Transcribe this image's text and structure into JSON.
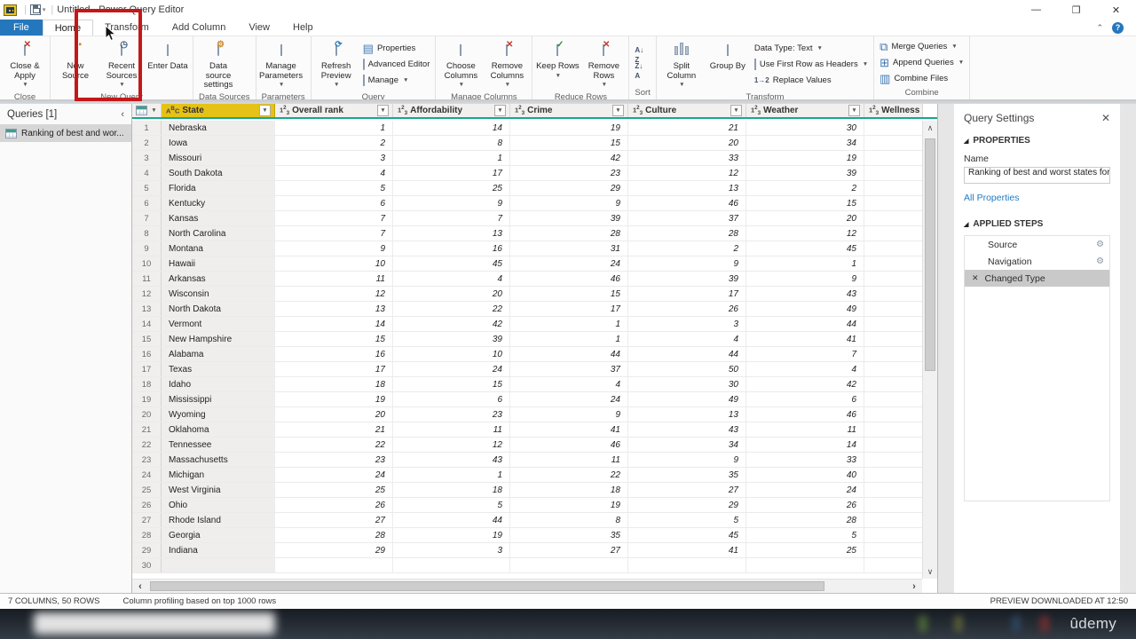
{
  "window": {
    "title": "Untitled - Power Query Editor"
  },
  "ribbon": {
    "tabs": [
      "File",
      "Home",
      "Transform",
      "Add Column",
      "View",
      "Help"
    ],
    "active_tab": "Home",
    "annotated_tab": "Transform",
    "groups": [
      {
        "label": "Close",
        "buttons": [
          {
            "kind": "big",
            "label": "Close & Apply",
            "caret": true,
            "icon": "close-apply-icon"
          }
        ]
      },
      {
        "label": "New Query",
        "buttons": [
          {
            "kind": "big",
            "label": "New Source",
            "caret": true,
            "icon": "new-source-icon"
          },
          {
            "kind": "big",
            "label": "Recent Sources",
            "caret": true,
            "icon": "recent-sources-icon"
          },
          {
            "kind": "big",
            "label": "Enter Data",
            "caret": false,
            "icon": "enter-data-icon"
          }
        ]
      },
      {
        "label": "Data Sources",
        "buttons": [
          {
            "kind": "big",
            "label": "Data source settings",
            "caret": false,
            "icon": "data-source-settings-icon"
          }
        ]
      },
      {
        "label": "Parameters",
        "buttons": [
          {
            "kind": "big",
            "label": "Manage Parameters",
            "caret": true,
            "icon": "manage-parameters-icon"
          }
        ]
      },
      {
        "label": "Query",
        "buttons": [
          {
            "kind": "big",
            "label": "Refresh Preview",
            "caret": true,
            "icon": "refresh-preview-icon"
          },
          {
            "kind": "stack",
            "items": [
              {
                "label": "Properties",
                "caret": false,
                "icon": "properties-icon"
              },
              {
                "label": "Advanced Editor",
                "caret": false,
                "icon": "advanced-editor-icon"
              },
              {
                "label": "Manage",
                "caret": true,
                "icon": "manage-icon"
              }
            ]
          }
        ]
      },
      {
        "label": "Manage Columns",
        "buttons": [
          {
            "kind": "big",
            "label": "Choose Columns",
            "caret": true,
            "icon": "choose-columns-icon"
          },
          {
            "kind": "big",
            "label": "Remove Columns",
            "caret": true,
            "icon": "remove-columns-icon"
          }
        ]
      },
      {
        "label": "Reduce Rows",
        "buttons": [
          {
            "kind": "big",
            "label": "Keep Rows",
            "caret": true,
            "icon": "keep-rows-icon"
          },
          {
            "kind": "big",
            "label": "Remove Rows",
            "caret": true,
            "icon": "remove-rows-icon"
          }
        ]
      },
      {
        "label": "Sort",
        "buttons": [
          {
            "kind": "stack",
            "items": [
              {
                "label": "",
                "caret": false,
                "icon": "sort-ascending-icon"
              },
              {
                "label": "",
                "caret": false,
                "icon": "sort-descending-icon"
              }
            ]
          }
        ]
      },
      {
        "label": "Transform",
        "buttons": [
          {
            "kind": "big",
            "label": "Split Column",
            "caret": true,
            "icon": "split-column-icon"
          },
          {
            "kind": "big",
            "label": "Group By",
            "caret": false,
            "icon": "group-by-icon"
          },
          {
            "kind": "stack",
            "items": [
              {
                "label": "Data Type: Text",
                "caret": true,
                "icon": "none"
              },
              {
                "label": "Use First Row as Headers",
                "caret": true,
                "icon": "first-row-headers-icon"
              },
              {
                "label": "Replace Values",
                "caret": false,
                "icon": "replace-values-icon"
              }
            ]
          }
        ]
      },
      {
        "label": "Combine",
        "buttons": [
          {
            "kind": "stack",
            "items": [
              {
                "label": "Merge Queries",
                "caret": true,
                "icon": "merge-queries-icon"
              },
              {
                "label": "Append Queries",
                "caret": true,
                "icon": "append-queries-icon"
              },
              {
                "label": "Combine Files",
                "caret": false,
                "icon": "combine-files-icon"
              }
            ]
          }
        ]
      }
    ]
  },
  "queries_panel": {
    "header": "Queries [1]",
    "items": [
      {
        "label": "Ranking of best and wor...",
        "selected": true
      }
    ]
  },
  "grid": {
    "columns": [
      {
        "label": "State",
        "type": "text",
        "selected": true,
        "filter": true
      },
      {
        "label": "Overall rank",
        "type": "number",
        "filter": true
      },
      {
        "label": "Affordability",
        "type": "number",
        "filter": true
      },
      {
        "label": "Crime",
        "type": "number",
        "filter": true
      },
      {
        "label": "Culture",
        "type": "number",
        "filter": true
      },
      {
        "label": "Weather",
        "type": "number",
        "filter": true
      },
      {
        "label": "Wellness",
        "type": "number",
        "filter": false
      }
    ],
    "rows": [
      [
        "Nebraska",
        1,
        14,
        19,
        21,
        30,
        ""
      ],
      [
        "Iowa",
        2,
        8,
        15,
        20,
        34,
        ""
      ],
      [
        "Missouri",
        3,
        1,
        42,
        33,
        19,
        ""
      ],
      [
        "South Dakota",
        4,
        17,
        23,
        12,
        39,
        ""
      ],
      [
        "Florida",
        5,
        25,
        29,
        13,
        2,
        ""
      ],
      [
        "Kentucky",
        6,
        9,
        9,
        46,
        15,
        ""
      ],
      [
        "Kansas",
        7,
        7,
        39,
        37,
        20,
        ""
      ],
      [
        "North Carolina",
        7,
        13,
        28,
        28,
        12,
        ""
      ],
      [
        "Montana",
        9,
        16,
        31,
        2,
        45,
        ""
      ],
      [
        "Hawaii",
        10,
        45,
        24,
        9,
        1,
        ""
      ],
      [
        "Arkansas",
        11,
        4,
        46,
        39,
        9,
        ""
      ],
      [
        "Wisconsin",
        12,
        20,
        15,
        17,
        43,
        ""
      ],
      [
        "North Dakota",
        13,
        22,
        17,
        26,
        49,
        ""
      ],
      [
        "Vermont",
        14,
        42,
        1,
        3,
        44,
        ""
      ],
      [
        "New Hampshire",
        15,
        39,
        1,
        4,
        41,
        ""
      ],
      [
        "Alabama",
        16,
        10,
        44,
        44,
        7,
        ""
      ],
      [
        "Texas",
        17,
        24,
        37,
        50,
        4,
        ""
      ],
      [
        "Idaho",
        18,
        15,
        4,
        30,
        42,
        ""
      ],
      [
        "Mississippi",
        19,
        6,
        24,
        49,
        6,
        ""
      ],
      [
        "Wyoming",
        20,
        23,
        9,
        13,
        46,
        ""
      ],
      [
        "Oklahoma",
        21,
        11,
        41,
        43,
        11,
        ""
      ],
      [
        "Tennessee",
        22,
        12,
        46,
        34,
        14,
        ""
      ],
      [
        "Massachusetts",
        23,
        43,
        11,
        9,
        33,
        ""
      ],
      [
        "Michigan",
        24,
        1,
        22,
        35,
        40,
        ""
      ],
      [
        "West Virginia",
        25,
        18,
        18,
        27,
        24,
        ""
      ],
      [
        "Ohio",
        26,
        5,
        19,
        29,
        26,
        ""
      ],
      [
        "Rhode Island",
        27,
        44,
        8,
        5,
        28,
        ""
      ],
      [
        "Georgia",
        28,
        19,
        35,
        45,
        5,
        ""
      ],
      [
        "Indiana",
        29,
        3,
        27,
        41,
        25,
        ""
      ]
    ],
    "visible_row_count": 30
  },
  "settings_panel": {
    "title": "Query Settings",
    "properties_label": "PROPERTIES",
    "name_label": "Name",
    "name_value": "Ranking of best and worst states for retire",
    "all_properties_label": "All Properties",
    "applied_steps_label": "APPLIED STEPS",
    "steps": [
      {
        "label": "Source",
        "gear": true,
        "selected": false
      },
      {
        "label": "Navigation",
        "gear": true,
        "selected": false
      },
      {
        "label": "Changed Type",
        "gear": false,
        "selected": true
      }
    ]
  },
  "status_bar": {
    "columns_rows": "7 COLUMNS, 50 ROWS",
    "profiling": "Column profiling based on top 1000 rows",
    "preview": "PREVIEW DOWNLOADED AT 12:50"
  },
  "footer": {
    "brand": "ûdemy"
  },
  "colors": {
    "accent_teal": "#16a78c",
    "selected_header_yellow": "#e6c217",
    "file_tab_blue": "#2577bd",
    "annotation_red": "#c41818"
  }
}
